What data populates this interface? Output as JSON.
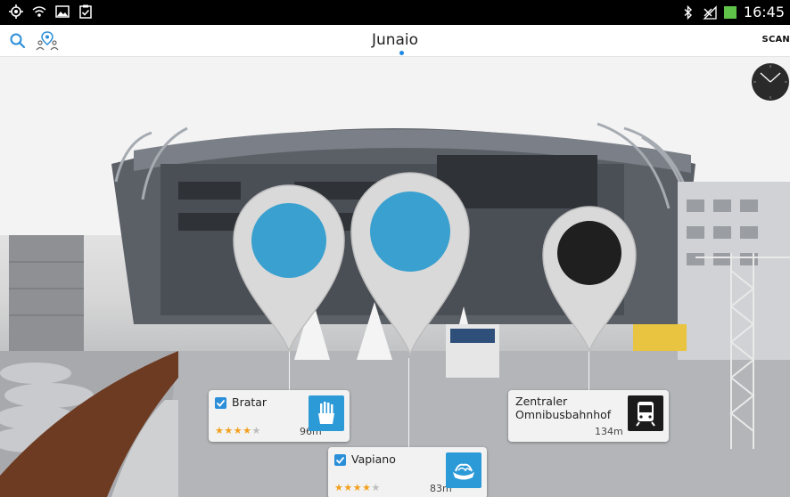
{
  "status_bar": {
    "time": "16:45",
    "left_icons": [
      "gps-icon",
      "wifi-icon",
      "image-icon",
      "clipboard-check-icon"
    ],
    "right_icons": [
      "bluetooth-icon",
      "no-signal-icon",
      "battery-icon"
    ]
  },
  "app_bar": {
    "title": "Junaio",
    "scan_label": "SCAN",
    "left_icons": [
      "search-icon",
      "location-people-icon"
    ],
    "accent_color": "#1e88e5"
  },
  "pois": [
    {
      "name": "Bratar",
      "rating": 4,
      "rating_max": 5,
      "distance": "96m",
      "category_icon": "fries-icon",
      "category_color": "#2d9ad8",
      "pin_color": "#3aa0cf"
    },
    {
      "name": "Vapiano",
      "rating": 4,
      "rating_max": 5,
      "distance": "83m",
      "category_icon": "pasta-icon",
      "category_color": "#2d9ad8",
      "pin_color": "#3aa0cf"
    },
    {
      "name": "Zentraler Omnibusbahnhof",
      "rating": null,
      "distance": "134m",
      "category_icon": "bus-icon",
      "category_color": "#1b1b1b",
      "pin_color": "#1f1f1f"
    }
  ],
  "compass_icon": "compass-icon"
}
